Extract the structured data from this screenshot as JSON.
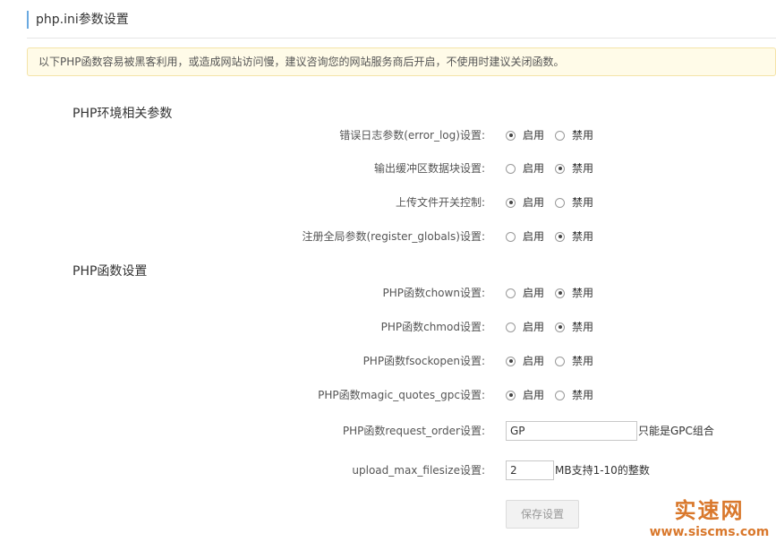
{
  "page": {
    "title": "php.ini参数设置"
  },
  "notice": {
    "text": "以下PHP函数容易被黑客利用，或造成网站访问慢，建议咨询您的网站服务商后开启，不使用时建议关闭函数。"
  },
  "section_env": {
    "title": "PHP环境相关参数",
    "rows": [
      {
        "label": "错误日志参数(error_log)设置:",
        "enable": "启用",
        "disable": "禁用",
        "selected": "enable"
      },
      {
        "label": "输出缓冲区数据块设置:",
        "enable": "启用",
        "disable": "禁用",
        "selected": "disable"
      },
      {
        "label": "上传文件开关控制:",
        "enable": "启用",
        "disable": "禁用",
        "selected": "enable"
      },
      {
        "label": "注册全局参数(register_globals)设置:",
        "enable": "启用",
        "disable": "禁用",
        "selected": "disable"
      }
    ]
  },
  "section_func": {
    "title": "PHP函数设置",
    "rows": [
      {
        "label": "PHP函数chown设置:",
        "enable": "启用",
        "disable": "禁用",
        "selected": "disable"
      },
      {
        "label": "PHP函数chmod设置:",
        "enable": "启用",
        "disable": "禁用",
        "selected": "disable"
      },
      {
        "label": "PHP函数fsockopen设置:",
        "enable": "启用",
        "disable": "禁用",
        "selected": "enable"
      },
      {
        "label": "PHP函数magic_quotes_gpc设置:",
        "enable": "启用",
        "disable": "禁用",
        "selected": "enable"
      }
    ],
    "request_order": {
      "label": "PHP函数request_order设置:",
      "value": "GP",
      "hint": "只能是GPC组合"
    },
    "upload_max_filesize": {
      "label": "upload_max_filesize设置:",
      "value": "2",
      "hint": "MB支持1-10的整数"
    }
  },
  "save_button": {
    "label": "保存设置"
  },
  "watermark": {
    "main": "实速网",
    "sub": "www.siscms.com"
  }
}
